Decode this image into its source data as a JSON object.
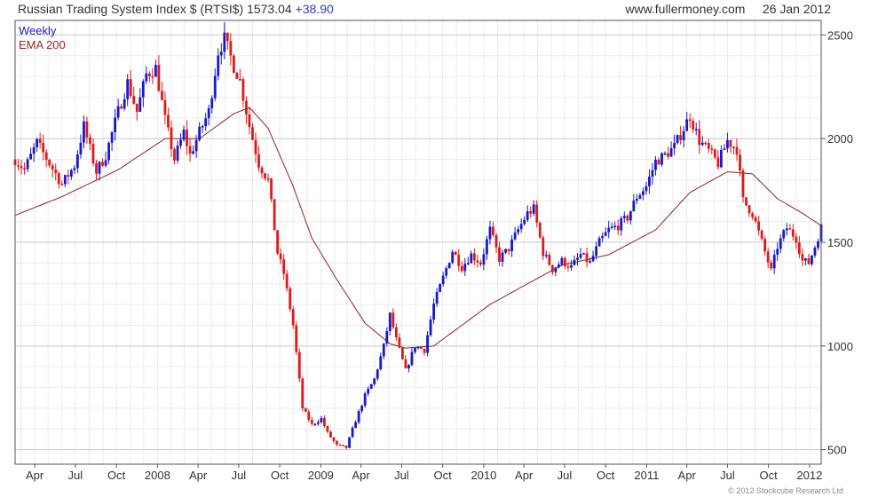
{
  "header": {
    "title": "Russian Trading System Index $ (RTSI$)",
    "last": "1573.04",
    "change": "+38.90",
    "website": "www.fullermoney.com",
    "date": "26 Jan 2012"
  },
  "legend": {
    "weekly": "Weekly",
    "ema": "EMA 200"
  },
  "copyright": "© 2012 Stockcube Research Ltd",
  "colors": {
    "up": "#1818cc",
    "down": "#e01818",
    "ema": "#9a1e1e",
    "grid": "#d9d9d9",
    "frame": "#555555",
    "text": "#333333"
  },
  "chart_data": {
    "type": "candlestick",
    "title": "Russian Trading System Index $ (RTSI$)",
    "timeframe": "Weekly",
    "x_range": [
      "2007-02-16",
      "2012-01-27"
    ],
    "ylim": [
      430,
      2570
    ],
    "y_ticks": [
      500,
      1000,
      1500,
      2000,
      2500
    ],
    "x_ticks": [
      {
        "label": "Apr",
        "date": "2007-04-01"
      },
      {
        "label": "Jul",
        "date": "2007-07-01"
      },
      {
        "label": "Oct",
        "date": "2007-10-01"
      },
      {
        "label": "2008",
        "date": "2008-01-01"
      },
      {
        "label": "Apr",
        "date": "2008-04-01"
      },
      {
        "label": "Jul",
        "date": "2008-07-01"
      },
      {
        "label": "Oct",
        "date": "2008-10-01"
      },
      {
        "label": "2009",
        "date": "2009-01-01"
      },
      {
        "label": "Apr",
        "date": "2009-04-01"
      },
      {
        "label": "Jul",
        "date": "2009-07-01"
      },
      {
        "label": "Oct",
        "date": "2009-10-01"
      },
      {
        "label": "2010",
        "date": "2010-01-01"
      },
      {
        "label": "Apr",
        "date": "2010-04-01"
      },
      {
        "label": "Jul",
        "date": "2010-07-01"
      },
      {
        "label": "Oct",
        "date": "2010-10-01"
      },
      {
        "label": "2011",
        "date": "2011-01-01"
      },
      {
        "label": "Apr",
        "date": "2011-04-01"
      },
      {
        "label": "Jul",
        "date": "2011-07-01"
      },
      {
        "label": "Oct",
        "date": "2011-10-01"
      },
      {
        "label": "2012",
        "date": "2012-01-01"
      }
    ],
    "grid": true,
    "close_path": [
      [
        "2007-02-16",
        1900
      ],
      [
        "2007-03-09",
        1850
      ],
      [
        "2007-04-06",
        1980
      ],
      [
        "2007-05-04",
        1880
      ],
      [
        "2007-06-01",
        1780
      ],
      [
        "2007-06-29",
        1870
      ],
      [
        "2007-07-20",
        2060
      ],
      [
        "2007-08-17",
        1840
      ],
      [
        "2007-09-07",
        1920
      ],
      [
        "2007-10-05",
        2130
      ],
      [
        "2007-10-26",
        2270
      ],
      [
        "2007-11-16",
        2130
      ],
      [
        "2007-12-07",
        2310
      ],
      [
        "2007-12-28",
        2340
      ],
      [
        "2008-01-18",
        2090
      ],
      [
        "2008-02-08",
        1900
      ],
      [
        "2008-02-29",
        2030
      ],
      [
        "2008-03-14",
        1920
      ],
      [
        "2008-04-04",
        2030
      ],
      [
        "2008-04-25",
        2130
      ],
      [
        "2008-05-16",
        2420
      ],
      [
        "2008-05-30",
        2480
      ],
      [
        "2008-06-20",
        2350
      ],
      [
        "2008-07-04",
        2280
      ],
      [
        "2008-07-25",
        2060
      ],
      [
        "2008-08-15",
        1880
      ],
      [
        "2008-09-05",
        1800
      ],
      [
        "2008-09-26",
        1450
      ],
      [
        "2008-10-10",
        1350
      ],
      [
        "2008-10-31",
        1100
      ],
      [
        "2008-11-21",
        700
      ],
      [
        "2008-12-12",
        620
      ],
      [
        "2009-01-02",
        650
      ],
      [
        "2009-01-16",
        580
      ],
      [
        "2009-02-06",
        520
      ],
      [
        "2009-02-27",
        510
      ],
      [
        "2009-03-20",
        640
      ],
      [
        "2009-04-10",
        760
      ],
      [
        "2009-05-01",
        840
      ],
      [
        "2009-05-22",
        1000
      ],
      [
        "2009-06-05",
        1150
      ],
      [
        "2009-06-19",
        1030
      ],
      [
        "2009-07-10",
        880
      ],
      [
        "2009-07-31",
        1000
      ],
      [
        "2009-08-21",
        980
      ],
      [
        "2009-09-11",
        1200
      ],
      [
        "2009-10-02",
        1330
      ],
      [
        "2009-10-23",
        1460
      ],
      [
        "2009-11-13",
        1380
      ],
      [
        "2009-12-04",
        1440
      ],
      [
        "2009-12-25",
        1400
      ],
      [
        "2010-01-15",
        1560
      ],
      [
        "2010-02-05",
        1420
      ],
      [
        "2010-02-26",
        1470
      ],
      [
        "2010-03-19",
        1560
      ],
      [
        "2010-04-09",
        1640
      ],
      [
        "2010-04-23",
        1660
      ],
      [
        "2010-05-14",
        1450
      ],
      [
        "2010-06-04",
        1370
      ],
      [
        "2010-06-25",
        1410
      ],
      [
        "2010-07-16",
        1380
      ],
      [
        "2010-08-06",
        1440
      ],
      [
        "2010-08-27",
        1400
      ],
      [
        "2010-09-17",
        1500
      ],
      [
        "2010-10-08",
        1560
      ],
      [
        "2010-10-29",
        1580
      ],
      [
        "2010-11-19",
        1620
      ],
      [
        "2010-12-10",
        1720
      ],
      [
        "2010-12-31",
        1770
      ],
      [
        "2011-01-21",
        1890
      ],
      [
        "2011-02-11",
        1920
      ],
      [
        "2011-03-04",
        1960
      ],
      [
        "2011-03-25",
        2050
      ],
      [
        "2011-04-08",
        2110
      ],
      [
        "2011-04-29",
        1990
      ],
      [
        "2011-05-20",
        1940
      ],
      [
        "2011-06-10",
        1880
      ],
      [
        "2011-07-01",
        1990
      ],
      [
        "2011-07-22",
        1950
      ],
      [
        "2011-08-05",
        1700
      ],
      [
        "2011-08-26",
        1640
      ],
      [
        "2011-09-16",
        1500
      ],
      [
        "2011-10-07",
        1360
      ],
      [
        "2011-10-21",
        1480
      ],
      [
        "2011-11-11",
        1570
      ],
      [
        "2011-12-02",
        1520
      ],
      [
        "2011-12-16",
        1410
      ],
      [
        "2011-12-30",
        1400
      ],
      [
        "2012-01-13",
        1480
      ],
      [
        "2012-01-27",
        1573
      ]
    ],
    "ema200": [
      [
        "2007-02-16",
        1630
      ],
      [
        "2007-06-01",
        1720
      ],
      [
        "2007-10-05",
        1850
      ],
      [
        "2008-01-18",
        2000
      ],
      [
        "2008-04-04",
        2000
      ],
      [
        "2008-06-20",
        2120
      ],
      [
        "2008-07-25",
        2150
      ],
      [
        "2008-09-05",
        2050
      ],
      [
        "2008-10-31",
        1770
      ],
      [
        "2008-12-12",
        1520
      ],
      [
        "2009-02-06",
        1320
      ],
      [
        "2009-04-10",
        1110
      ],
      [
        "2009-06-05",
        1010
      ],
      [
        "2009-07-10",
        990
      ],
      [
        "2009-09-11",
        1000
      ],
      [
        "2009-11-13",
        1100
      ],
      [
        "2010-01-15",
        1200
      ],
      [
        "2010-04-09",
        1300
      ],
      [
        "2010-06-25",
        1390
      ],
      [
        "2010-10-08",
        1440
      ],
      [
        "2011-01-21",
        1560
      ],
      [
        "2011-04-08",
        1740
      ],
      [
        "2011-07-01",
        1840
      ],
      [
        "2011-08-26",
        1830
      ],
      [
        "2011-10-21",
        1710
      ],
      [
        "2011-12-16",
        1640
      ],
      [
        "2012-01-27",
        1580
      ]
    ]
  }
}
